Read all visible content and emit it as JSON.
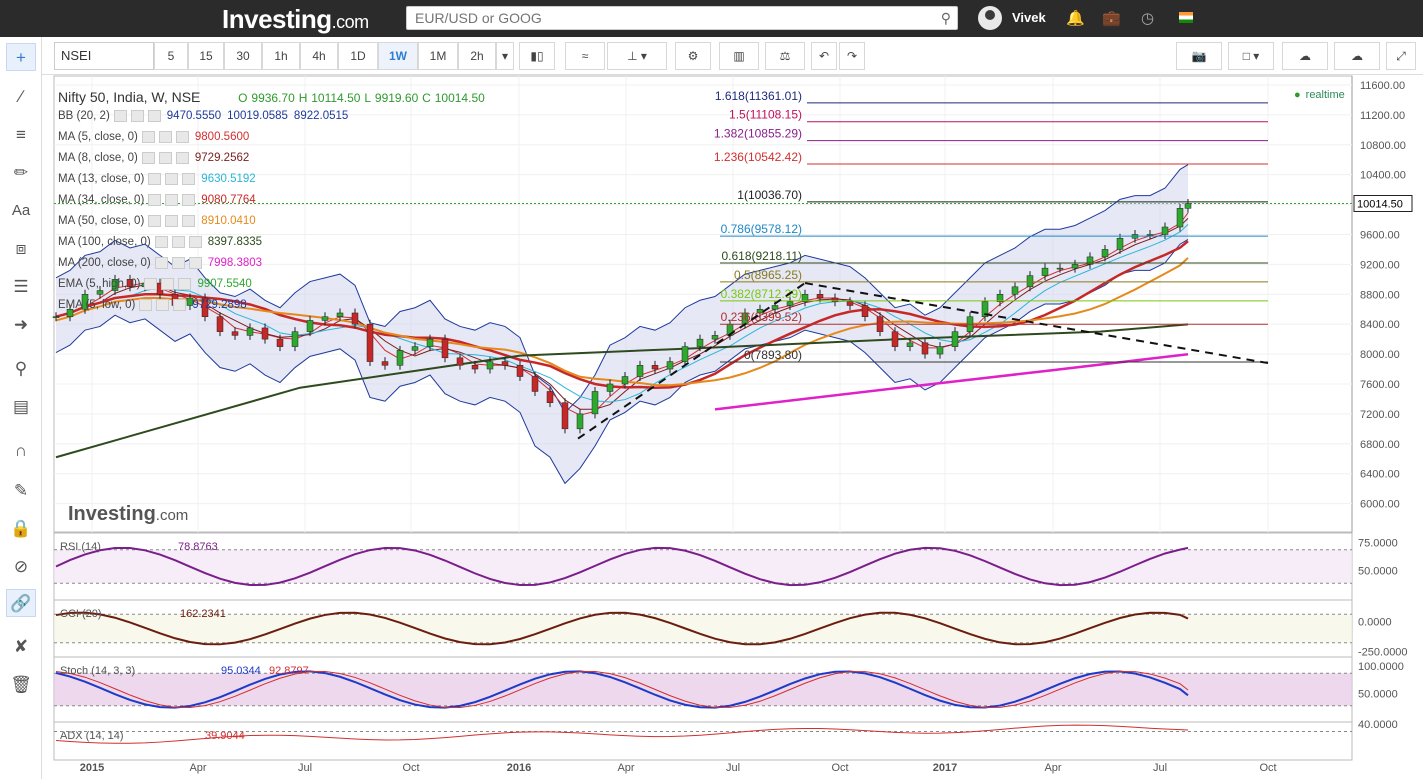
{
  "header": {
    "logo": "Investing",
    "logo_suffix": ".com",
    "search_placeholder": "EUR/USD or GOOG",
    "user_name": "Vivek"
  },
  "toolbar": {
    "symbol": "NSEI",
    "intervals": [
      "5",
      "15",
      "30",
      "1h",
      "4h",
      "1D",
      "1W",
      "1M",
      "2h"
    ],
    "selected_interval": "1W"
  },
  "legend": {
    "title": "Nifty 50, India, W, NSE",
    "o_label": "O",
    "o": "9936.70",
    "h_label": "H",
    "h": "10114.50",
    "l_label": "L",
    "l": "9919.60",
    "c_label": "C",
    "c": "10014.50",
    "realtime": "realtime",
    "indicators": [
      {
        "name": "BB (20, 2)",
        "values": [
          "9470.5550",
          "10019.0585",
          "8922.0515"
        ],
        "color": "#1e3a9c"
      },
      {
        "name": "MA (5, close, 0)",
        "values": [
          "9800.5600"
        ],
        "color": "#d32f2f"
      },
      {
        "name": "MA (8, close, 0)",
        "values": [
          "9729.2562"
        ],
        "color": "#7b1e1e"
      },
      {
        "name": "MA (13, close, 0)",
        "values": [
          "9630.5192"
        ],
        "color": "#29b6d8"
      },
      {
        "name": "MA (34, close, 0)",
        "values": [
          "9080.7764"
        ],
        "color": "#c62828"
      },
      {
        "name": "MA (50, close, 0)",
        "values": [
          "8910.0410"
        ],
        "color": "#e6891c"
      },
      {
        "name": "MA (100, close, 0)",
        "values": [
          "8397.8335"
        ],
        "color": "#2e4a1e"
      },
      {
        "name": "MA (200, close, 0)",
        "values": [
          "7998.3803"
        ],
        "color": "#e020c8"
      },
      {
        "name": "EMA (5, high, 0)",
        "values": [
          "9907.5540"
        ],
        "color": "#2ea82e"
      },
      {
        "name": "EMA (5, low, 0)",
        "values": [
          "9729.2898"
        ],
        "color": "#1e3a9c"
      }
    ]
  },
  "fib_levels": [
    {
      "label": "1.618(11361.01)",
      "price": 11361.01,
      "color": "#1e2a7c"
    },
    {
      "label": "1.5(11108.15)",
      "price": 11108.15,
      "color": "#c0105c"
    },
    {
      "label": "1.382(10855.29)",
      "price": 10855.29,
      "color": "#8a1e8a"
    },
    {
      "label": "1.236(10542.42)",
      "price": 10542.42,
      "color": "#d32f2f"
    },
    {
      "label": "1(10036.70)",
      "price": 10036.7,
      "color": "#222"
    },
    {
      "label": "0.786(9578.12)",
      "price": 9578.12,
      "color": "#1e88c8"
    },
    {
      "label": "0.618(9218.11)",
      "price": 9218.11,
      "color": "#2e4a1e"
    },
    {
      "label": "0.5(8965.25)",
      "price": 8965.25,
      "color": "#8a7a1e"
    },
    {
      "label": "0.382(8712.39)",
      "price": 8712.39,
      "color": "#7ac80e"
    },
    {
      "label": "0.236(8399.52)",
      "price": 8399.52,
      "color": "#b03030"
    },
    {
      "label": "0(7893.80)",
      "price": 7893.8,
      "color": "#333"
    }
  ],
  "price_axis": {
    "ticks": [
      "11600.00",
      "11200.00",
      "10800.00",
      "10400.00",
      "10000.00",
      "9600.00",
      "9200.00",
      "8800.00",
      "8400.00",
      "8000.00",
      "7600.00",
      "7200.00",
      "6800.00",
      "6400.00",
      "6000.00"
    ],
    "last": "10014.50"
  },
  "time_axis": [
    "2015",
    "Apr",
    "Jul",
    "Oct",
    "2016",
    "Apr",
    "Jul",
    "Oct",
    "2017",
    "Apr",
    "Jul",
    "Oct"
  ],
  "watermark": "Investing",
  "watermark_suffix": ".com",
  "subpanes": [
    {
      "name": "RSI (14)",
      "value": "78.8763",
      "color": "#7a1e8a",
      "ticks": [
        "75.0000",
        "50.0000"
      ]
    },
    {
      "name": "CCI (20)",
      "value": "162.2341",
      "color": "#6b1e0e",
      "ticks": [
        "0.0000",
        "-250.0000"
      ]
    },
    {
      "name": "Stoch (14, 3, 3)",
      "values": [
        "95.0344",
        "92.8797"
      ],
      "colors": [
        "#1e3ac8",
        "#d32f2f"
      ],
      "ticks": [
        "100.0000",
        "50.0000"
      ]
    },
    {
      "name": "ADX (14, 14)",
      "value": "39.9044",
      "color": "#d32f2f",
      "ticks": [
        "40.0000"
      ]
    }
  ]
}
